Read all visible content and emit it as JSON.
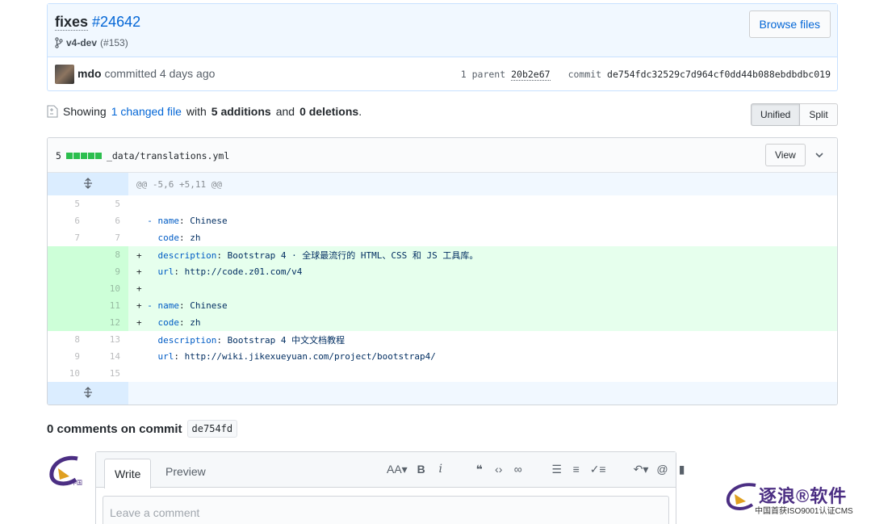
{
  "commit": {
    "message": "fixes",
    "issue": "#24642",
    "branch": "v4-dev",
    "pr": "(#153)",
    "browse_label": "Browse files",
    "author": "mdo",
    "action": "committed",
    "when": "4 days ago",
    "parent_label": "1 parent",
    "parent_sha": "20b2e67",
    "commit_label": "commit",
    "sha": "de754fdc32529c7d964cf0dd44b088ebdbdbc019"
  },
  "toc": {
    "showing": "Showing",
    "changed": "1 changed file",
    "with": "with",
    "additions": "5 additions",
    "and": "and",
    "deletions": "0 deletions",
    "period": ".",
    "unified": "Unified",
    "split": "Split"
  },
  "file": {
    "count": "5",
    "path": "_data/translations.yml",
    "view_label": "View",
    "hunk": "@@ -5,6 +5,11 @@",
    "lines": [
      {
        "type": "ctx",
        "old": "5",
        "new": "5",
        "sign": " ",
        "key": "",
        "sep": "",
        "val": ""
      },
      {
        "type": "ctx",
        "old": "6",
        "new": "6",
        "sign": " ",
        "key": "- name",
        "sep": ": ",
        "val": "Chinese"
      },
      {
        "type": "ctx",
        "old": "7",
        "new": "7",
        "sign": " ",
        "key": "  code",
        "sep": ": ",
        "val": "zh"
      },
      {
        "type": "add",
        "old": "",
        "new": "8",
        "sign": "+",
        "key": "  description",
        "sep": ": ",
        "val": "Bootstrap 4 · 全球最流行的 HTML、CSS 和 JS 工具库。"
      },
      {
        "type": "add",
        "old": "",
        "new": "9",
        "sign": "+",
        "key": "  url",
        "sep": ": ",
        "val": "http://code.z01.com/v4"
      },
      {
        "type": "add",
        "old": "",
        "new": "10",
        "sign": "+",
        "key": "",
        "sep": "",
        "val": ""
      },
      {
        "type": "add",
        "old": "",
        "new": "11",
        "sign": "+",
        "key": "- name",
        "sep": ": ",
        "val": "Chinese"
      },
      {
        "type": "add",
        "old": "",
        "new": "12",
        "sign": "+",
        "key": "  code",
        "sep": ": ",
        "val": "zh"
      },
      {
        "type": "ctx",
        "old": "8",
        "new": "13",
        "sign": " ",
        "key": "  description",
        "sep": ": ",
        "val": "Bootstrap 4 中文文档教程"
      },
      {
        "type": "ctx",
        "old": "9",
        "new": "14",
        "sign": " ",
        "key": "  url",
        "sep": ": ",
        "val": "http://wiki.jikexueyuan.com/project/bootstrap4/"
      },
      {
        "type": "ctx",
        "old": "10",
        "new": "15",
        "sign": " ",
        "key": "",
        "sep": "",
        "val": ""
      }
    ]
  },
  "comments": {
    "title": "0 comments on commit",
    "sha": "de754fd",
    "write": "Write",
    "preview": "Preview",
    "placeholder": "Leave a comment"
  },
  "watermark": {
    "title": "逐浪®软件",
    "subtitle": "中国首获ISO9001认证CMS"
  }
}
